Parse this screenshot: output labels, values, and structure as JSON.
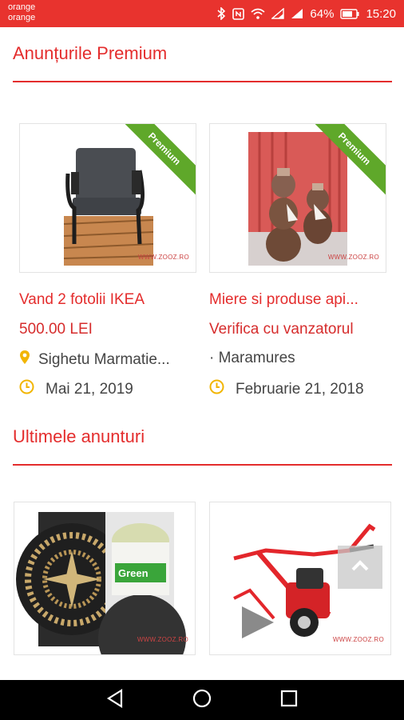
{
  "status_bar": {
    "carrier_line1": "orange",
    "carrier_line2": "orange",
    "battery": "64%",
    "time": "15:20"
  },
  "sections": {
    "premium_title": "Anunțurile Premium",
    "latest_title": "Ultimele anunturi"
  },
  "premium_listings": [
    {
      "title": "Vand 2 fotolii IKEA",
      "price": "500.00 LEI",
      "location": "Sighetu Marmatie...",
      "date": "Mai 21, 2019",
      "ribbon": "Premium",
      "watermark": "WWW.ZOOZ.RO"
    },
    {
      "title": "Miere si produse api...",
      "price": "Verifica cu vanzatorul",
      "location": "· Maramures",
      "date": "Februarie 21, 2018",
      "ribbon": "Premium",
      "watermark": "WWW.ZOOZ.RO"
    }
  ],
  "latest_listings": [
    {
      "watermark": "WWW.ZOOZ.RO"
    },
    {
      "watermark": "WWW.ZOOZ.RO"
    }
  ],
  "icons": {
    "location": "map-pin-icon",
    "date": "clock-icon",
    "scroll_top": "chevron-up-icon"
  },
  "colors": {
    "accent": "#e42d2d",
    "status_bar": "#e8332e",
    "ribbon": "#5fa82a",
    "icon_yellow": "#f2b500"
  }
}
